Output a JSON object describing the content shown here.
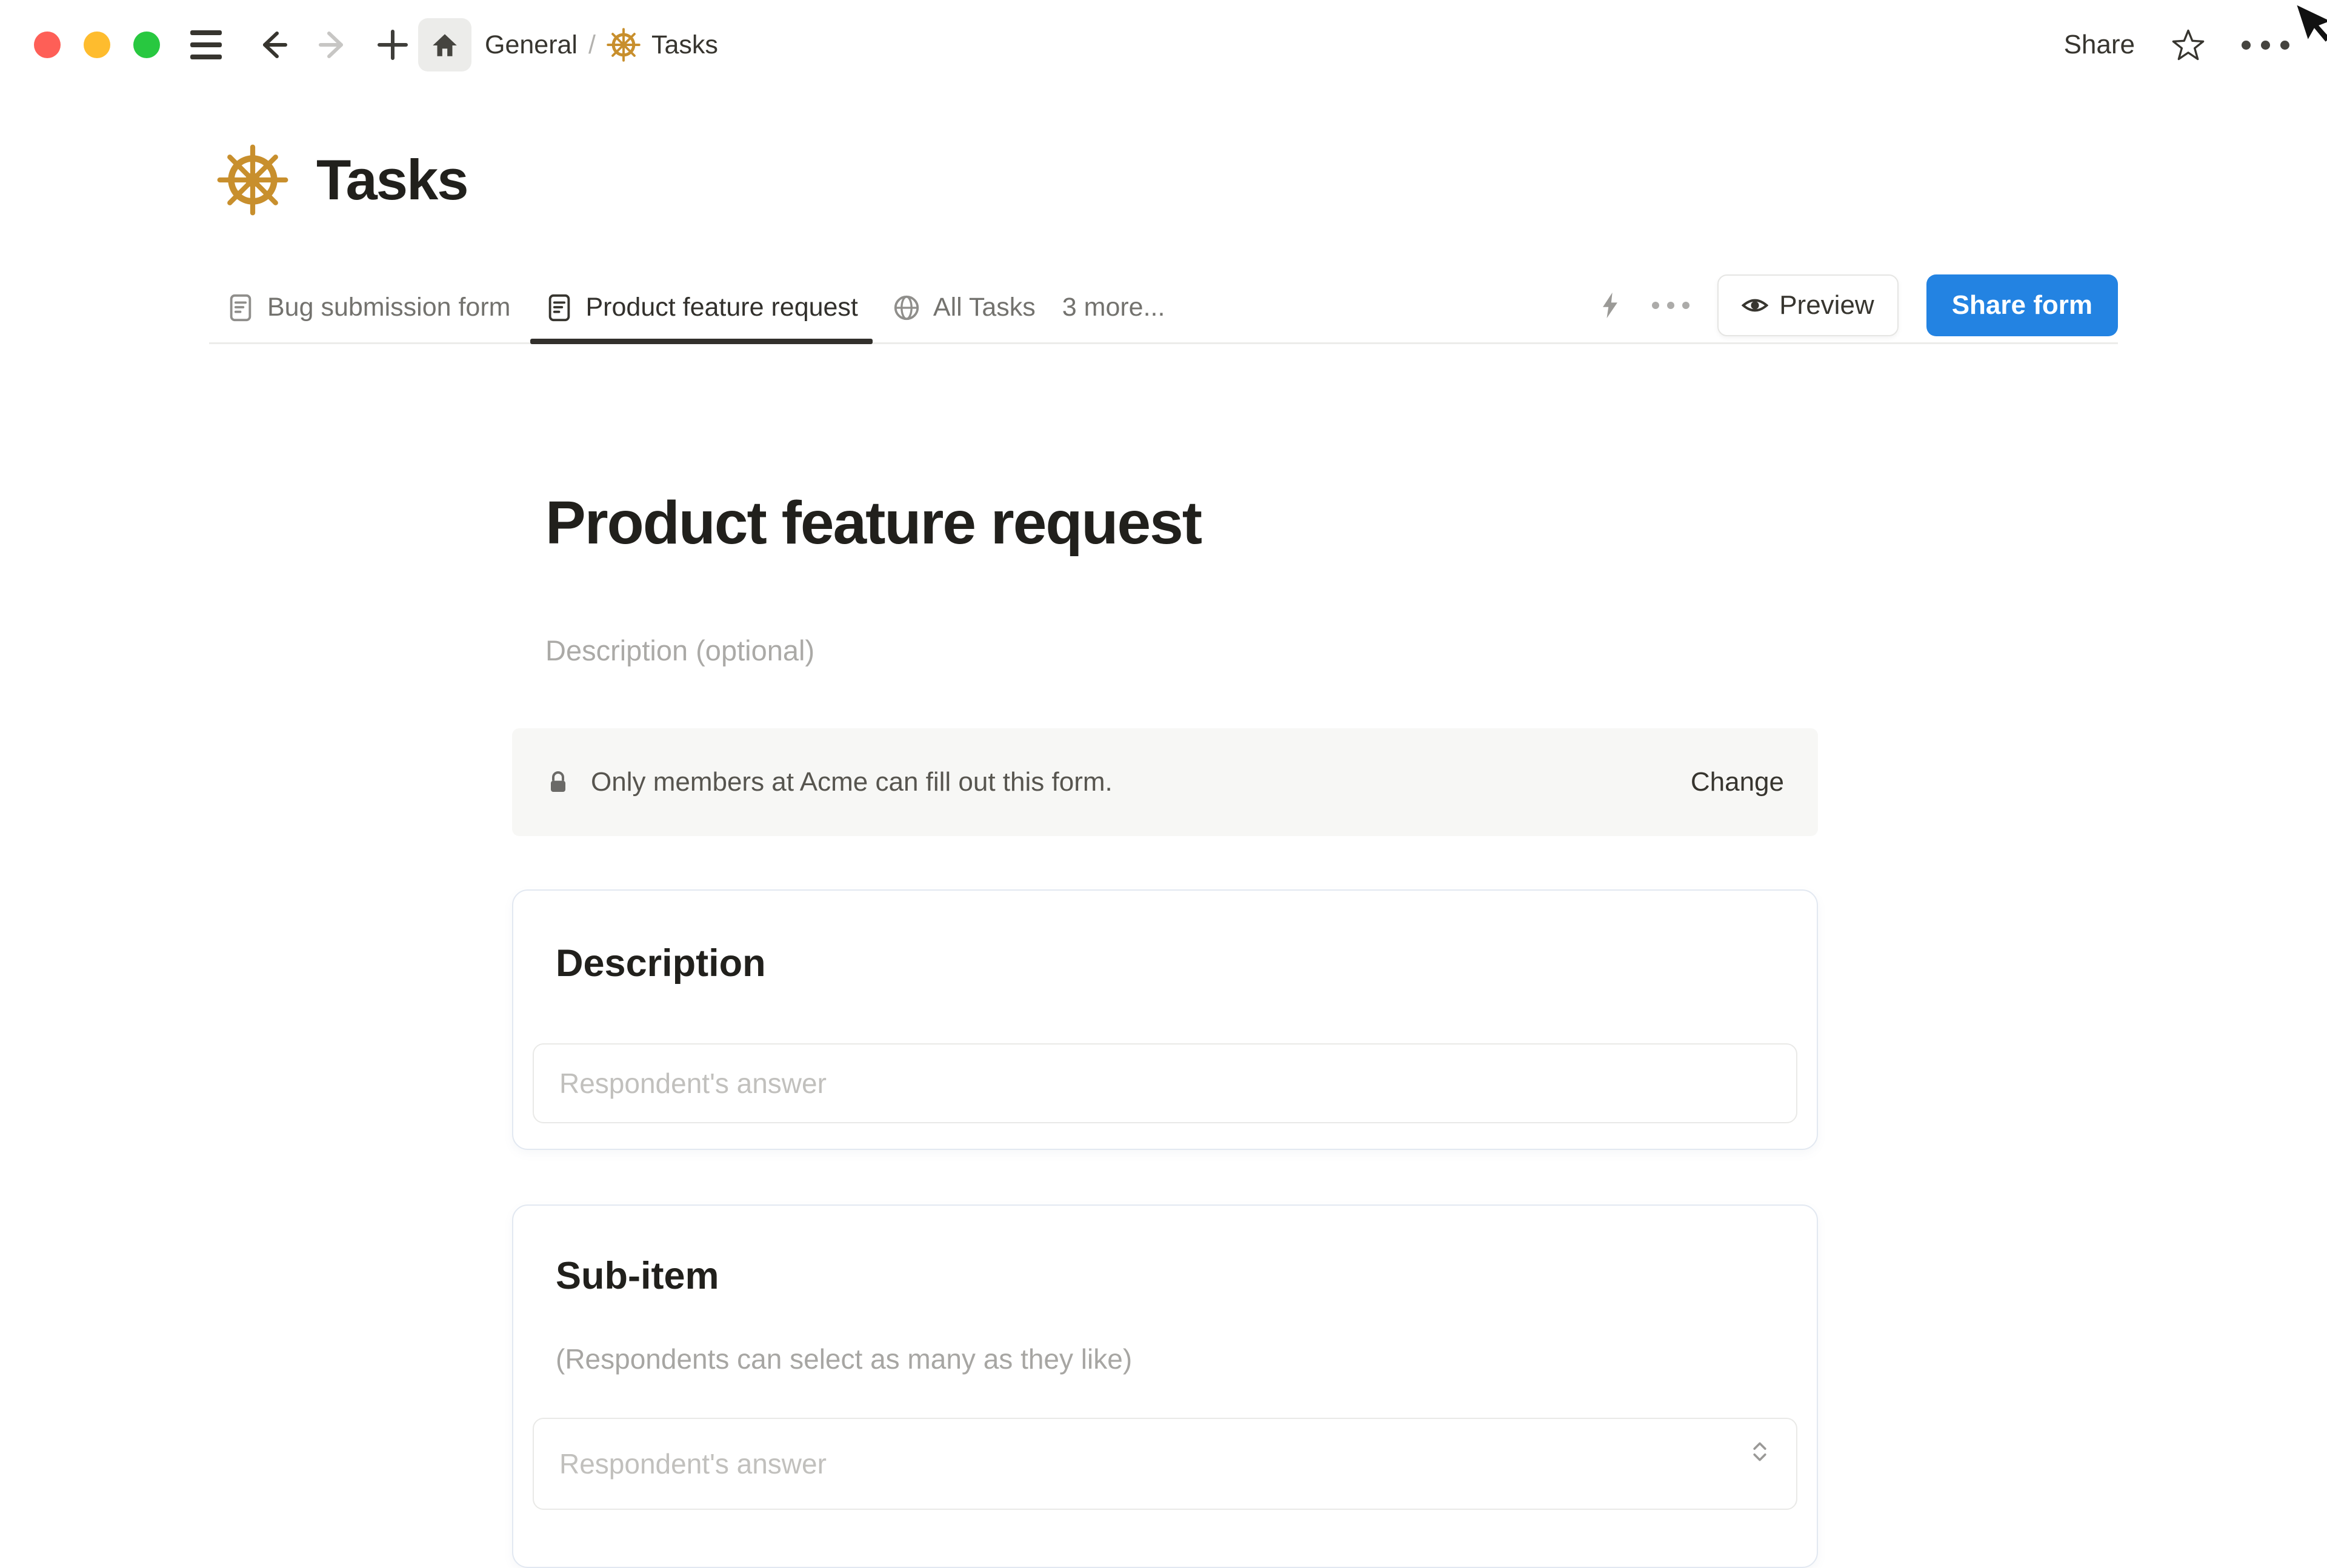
{
  "colors": {
    "accent_blue": "#2383E2",
    "wheel_gold": "#C88F2D",
    "active_text": "#32302C",
    "muted_text": "#73726E",
    "banner_bg": "#F7F7F5"
  },
  "topbar": {
    "breadcrumb_workspace": "General",
    "breadcrumb_separator": "/",
    "breadcrumb_page": "Tasks",
    "share_label": "Share"
  },
  "page": {
    "icon": "ship-wheel-icon",
    "title": "Tasks"
  },
  "tabs": {
    "items": [
      {
        "icon": "form-doc-icon",
        "label": "Bug submission form",
        "active": false
      },
      {
        "icon": "form-doc-icon",
        "label": "Product feature request",
        "active": true
      },
      {
        "icon": "globe-icon",
        "label": "All Tasks",
        "active": false
      },
      {
        "icon": "",
        "label": "3 more...",
        "active": false
      }
    ]
  },
  "toolbar": {
    "preview_label": "Preview",
    "share_form_label": "Share form"
  },
  "form": {
    "title": "Product feature request",
    "description_placeholder": "Description (optional)",
    "banner": {
      "icon": "lock-icon",
      "text": "Only members at Acme can fill out this form.",
      "action_label": "Change"
    },
    "questions": [
      {
        "title": "Description",
        "placeholder": "Respondent's answer"
      },
      {
        "title": "Sub-item",
        "hint": "(Respondents can select as many as they like)",
        "placeholder": "Respondent's answer"
      }
    ]
  }
}
